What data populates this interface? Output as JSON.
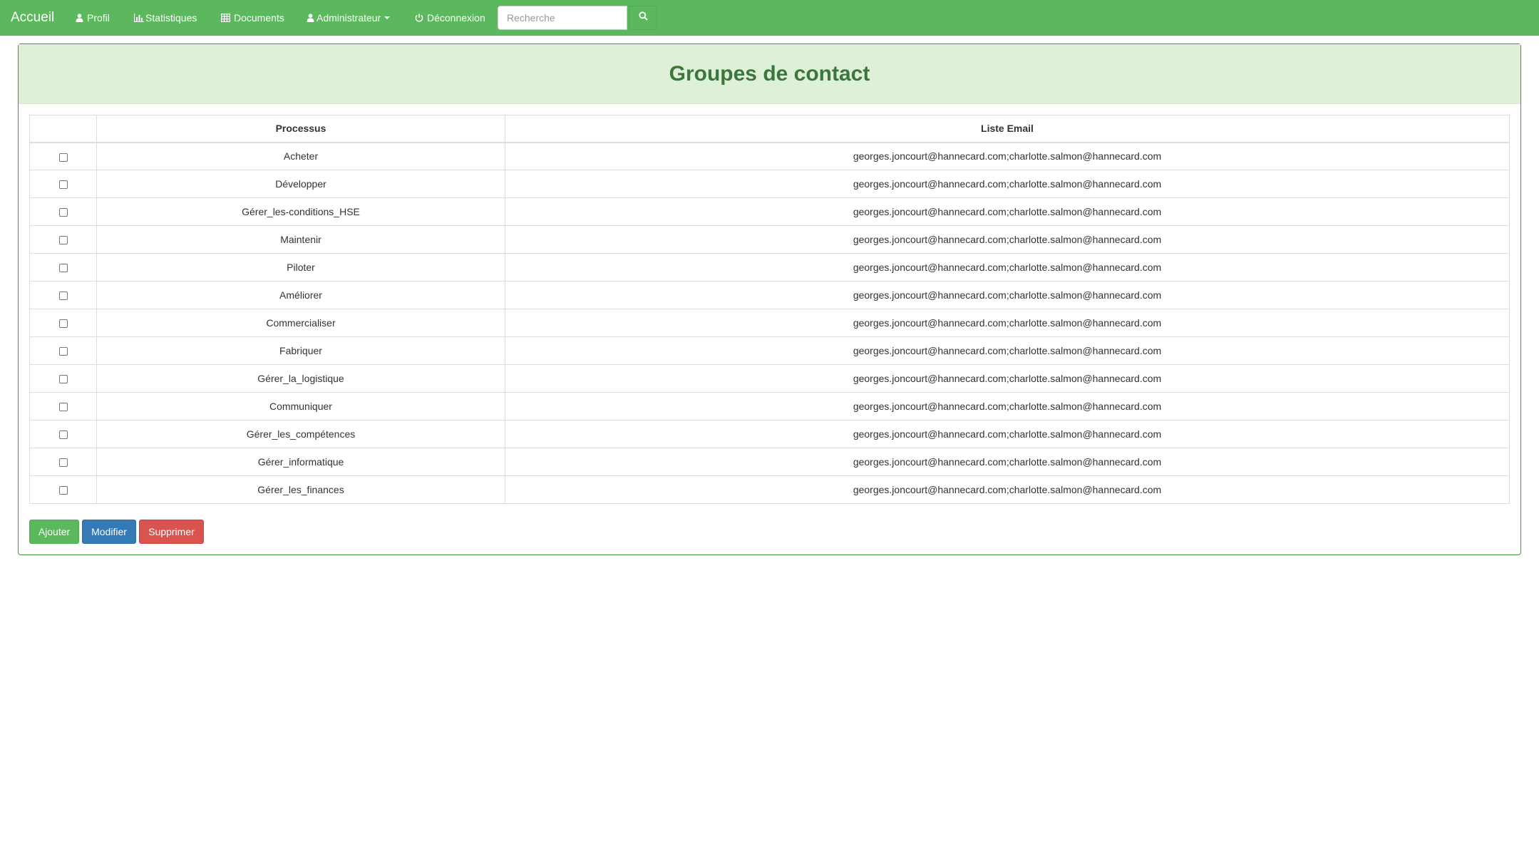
{
  "navbar": {
    "brand": "Accueil",
    "items": [
      {
        "label": "Profil",
        "icon": "user-icon"
      },
      {
        "label": "Statistiques",
        "icon": "bar-chart-icon"
      },
      {
        "label": "Documents",
        "icon": "table-icon"
      },
      {
        "label": "Administrateur",
        "icon": "user-icon",
        "dropdown": true
      },
      {
        "label": "Déconnexion",
        "icon": "power-icon"
      }
    ],
    "search": {
      "placeholder": "Recherche",
      "value": "",
      "icon": "search-icon"
    },
    "background_color": "#5cb85c"
  },
  "panel": {
    "title": "Groupes de contact",
    "heading_color": "#dff0d8",
    "title_color": "#3c763d"
  },
  "table": {
    "columns": [
      "",
      "Processus",
      "Liste Email"
    ],
    "rows": [
      {
        "processus": "Acheter",
        "emails": "georges.joncourt@hannecard.com;charlotte.salmon@hannecard.com",
        "checked": false
      },
      {
        "processus": "Développer",
        "emails": "georges.joncourt@hannecard.com;charlotte.salmon@hannecard.com",
        "checked": false
      },
      {
        "processus": "Gérer_les-conditions_HSE",
        "emails": "georges.joncourt@hannecard.com;charlotte.salmon@hannecard.com",
        "checked": false
      },
      {
        "processus": "Maintenir",
        "emails": "georges.joncourt@hannecard.com;charlotte.salmon@hannecard.com",
        "checked": false
      },
      {
        "processus": "Piloter",
        "emails": "georges.joncourt@hannecard.com;charlotte.salmon@hannecard.com",
        "checked": false
      },
      {
        "processus": "Améliorer",
        "emails": "georges.joncourt@hannecard.com;charlotte.salmon@hannecard.com",
        "checked": false
      },
      {
        "processus": "Commercialiser",
        "emails": "georges.joncourt@hannecard.com;charlotte.salmon@hannecard.com",
        "checked": false
      },
      {
        "processus": "Fabriquer",
        "emails": "georges.joncourt@hannecard.com;charlotte.salmon@hannecard.com",
        "checked": false
      },
      {
        "processus": "Gérer_la_logistique",
        "emails": "georges.joncourt@hannecard.com;charlotte.salmon@hannecard.com",
        "checked": false
      },
      {
        "processus": "Communiquer",
        "emails": "georges.joncourt@hannecard.com;charlotte.salmon@hannecard.com",
        "checked": false
      },
      {
        "processus": "Gérer_les_compétences",
        "emails": "georges.joncourt@hannecard.com;charlotte.salmon@hannecard.com",
        "checked": false
      },
      {
        "processus": "Gérer_informatique",
        "emails": "georges.joncourt@hannecard.com;charlotte.salmon@hannecard.com",
        "checked": false
      },
      {
        "processus": "Gérer_les_finances",
        "emails": "georges.joncourt@hannecard.com;charlotte.salmon@hannecard.com",
        "checked": false
      }
    ]
  },
  "actions": {
    "add_label": "Ajouter",
    "edit_label": "Modifier",
    "delete_label": "Supprimer",
    "colors": {
      "add": "#5cb85c",
      "edit": "#337ab7",
      "delete": "#d9534f"
    }
  }
}
